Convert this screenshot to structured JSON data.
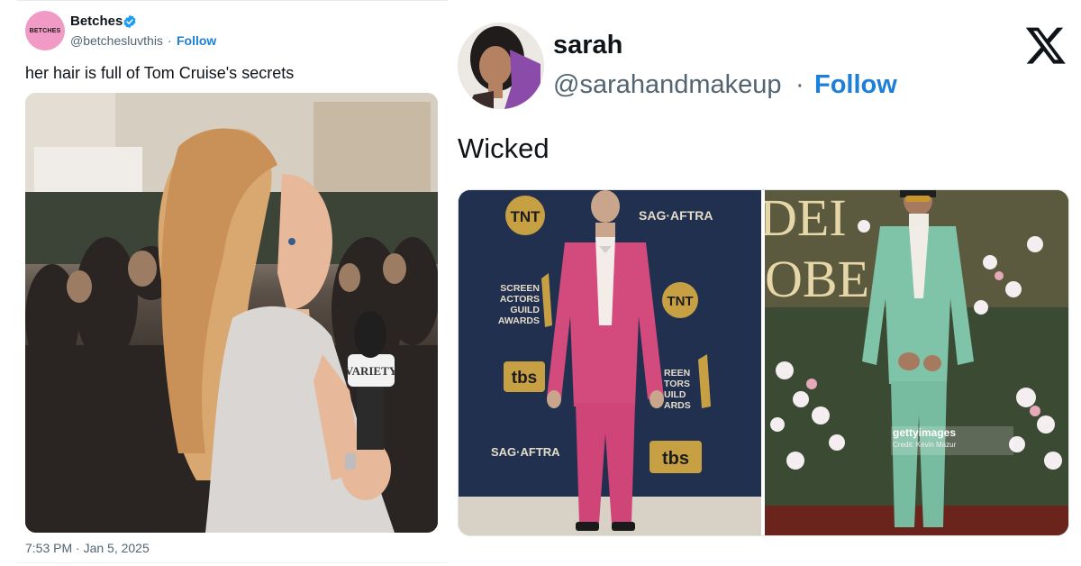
{
  "left_tweet": {
    "avatar_text": "BETCHES",
    "display_name": "Betches",
    "handle": "@betchesluvthis",
    "separator": "·",
    "follow_label": "Follow",
    "text": "her hair is full of Tom Cruise's secrets",
    "photo_overlay": "VARIETY",
    "timestamp": "7:53 PM · Jan 5, 2025"
  },
  "right_tweet": {
    "display_name": "sarah",
    "handle": "@sarahandmakeup",
    "separator": "·",
    "follow_label": "Follow",
    "text": "Wicked",
    "photo_a_logos": {
      "tnt_top": "TNT",
      "sag_top": "SAG·AFTRA",
      "sag_awards_1": "SCREEN",
      "sag_awards_2": "ACTORS",
      "sag_awards_3": "GUILD",
      "sag_awards_4": "AWARDS",
      "tnt_mid": "TNT",
      "tbs_left": "tbs",
      "sag_awards_r1": "REEN",
      "sag_awards_r2": "TORS",
      "sag_awards_r3": "UILD",
      "sag_awards_r4": "ARDS",
      "sag_bottom": "SAG·AFTRA",
      "tbs_bottom": "tbs"
    },
    "photo_b_logos": {
      "backdrop_top": "DEI",
      "backdrop_mid": "OBE",
      "getty": "gettyimages",
      "credit": "Credit: Kevin Mazur"
    }
  },
  "colors": {
    "follow": "#1d7fd8",
    "secondary_text": "#536471",
    "betches_pink": "#f19ac5",
    "pink_suit": "#d34a7d",
    "mint_suit": "#7fc3a8"
  }
}
